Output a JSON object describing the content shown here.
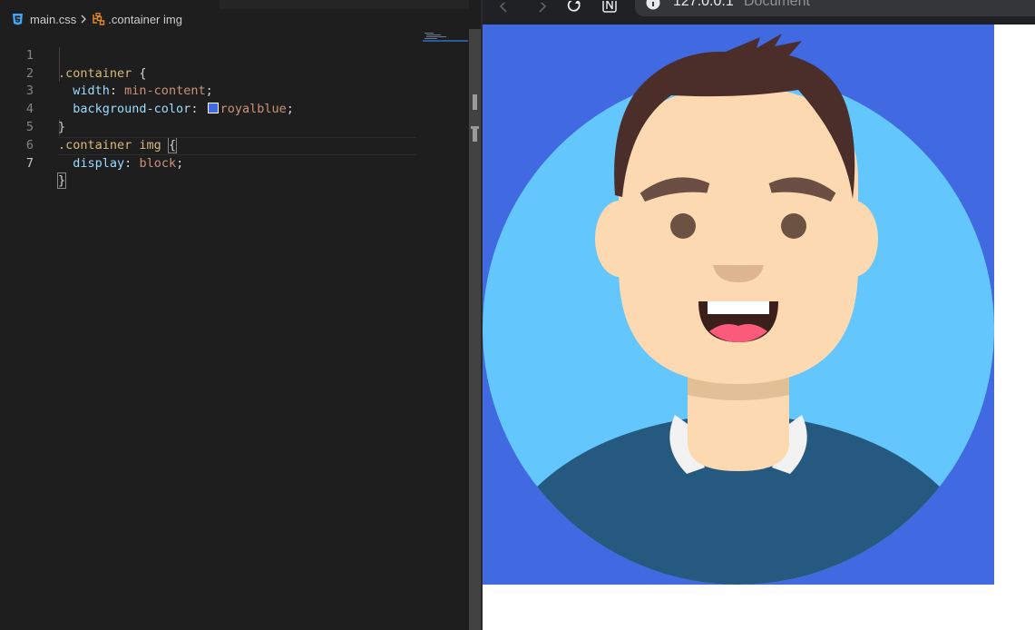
{
  "editor": {
    "breadcrumb": {
      "file": "main.css",
      "selector": ".container img",
      "file_icon": "css3-icon",
      "selector_icon": "css-selector-icon",
      "separator_icon": "chevron-right-icon"
    },
    "line_numbers": [
      "1",
      "2",
      "3",
      "4",
      "5",
      "6",
      "7"
    ],
    "current_line": "7",
    "code": {
      "l1_selector": ".container",
      "l1_brace": " {",
      "l2_prop": "width",
      "l2_colon": ": ",
      "l2_value": "min-content",
      "l2_semi": ";",
      "l3_prop": "background-color",
      "l3_colon": ": ",
      "l3_value": "royalblue",
      "l3_semi": ";",
      "l4_brace": "}",
      "l5_selector": ".container img",
      "l5_space": " ",
      "l5_brace": "{",
      "l6_prop": "display",
      "l6_colon": ": ",
      "l6_value": "block",
      "l6_semi": ";",
      "l7_brace": "}"
    },
    "swatch_color": "#4169e1"
  },
  "browser": {
    "back_icon": "back-arrow-icon",
    "forward_icon": "forward-arrow-icon",
    "reload_icon": "reload-icon",
    "extension_icon": "notion-extension-icon",
    "info_icon": "site-info-icon",
    "url": "127.0.0.1",
    "page_title": "Document",
    "container_color": "#4169e1",
    "avatar_image": "avatar-illustration"
  }
}
